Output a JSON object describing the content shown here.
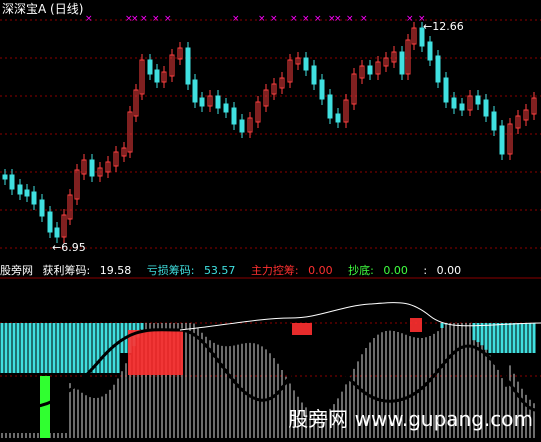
{
  "header": {
    "title": "深深宝A",
    "period": "(日线)"
  },
  "price_panel": {
    "high_label": "12.66",
    "low_label": "6.95",
    "arrow": "←"
  },
  "indicators": {
    "name": "股旁网",
    "items": [
      {
        "label": "获利筹码:",
        "value": "19.58",
        "color": "#ffffff"
      },
      {
        "label": "亏损筹码:",
        "value": "53.57",
        "color": "#40e0e0"
      },
      {
        "label": "主力控筹:",
        "value": "0.00",
        "color": "#ff3030"
      },
      {
        "label": "抄底:",
        "value": "0.00",
        "color": "#40ff40"
      },
      {
        "label": ":",
        "value": "0.00",
        "color": "#ffffff"
      }
    ]
  },
  "watermark": {
    "text": "股旁网 www.gupang.com"
  },
  "colors": {
    "up_candle": "#ff4040",
    "down_candle": "#40e0e0",
    "grid": "#8b0000",
    "marker": "#ff00ff",
    "profit_bars": "#ffffff",
    "loss_bars": "#40e0e0",
    "main_control": "#ff3030",
    "bottom_signal": "#30ff30"
  }
}
